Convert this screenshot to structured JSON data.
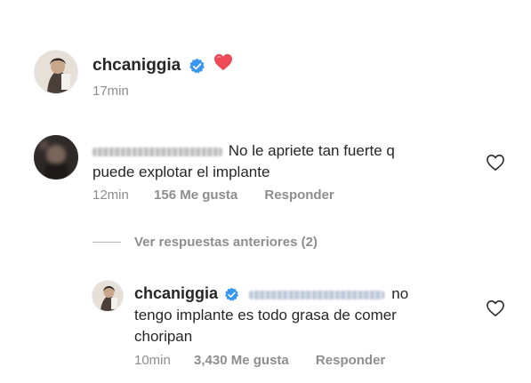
{
  "caption": {
    "username": "chcaniggia",
    "emoji": "❤️",
    "time": "17min"
  },
  "comment": {
    "text_line1": "No le apriete tan fuerte q",
    "text_line2": "puede explotar el implante",
    "time": "12min",
    "likes": "156 Me gusta",
    "reply_label": "Responder"
  },
  "view_replies": {
    "label": "Ver respuestas anteriores (2)"
  },
  "reply": {
    "username": "chcaniggia",
    "text_end_line1": "no",
    "text_line2": "tengo implante es todo grasa de comer",
    "text_line3": "choripan",
    "time": "10min",
    "likes": "3,430 Me gusta",
    "reply_label": "Responder"
  },
  "colors": {
    "text": "#262626",
    "muted": "#8e8e8e",
    "verified_blue": "#3897f0",
    "heart_red": "#ed4956"
  },
  "icons": {
    "verified": "verified-badge-icon",
    "heart": "heart-outline-icon",
    "emoji": "red-heart-emoji"
  }
}
